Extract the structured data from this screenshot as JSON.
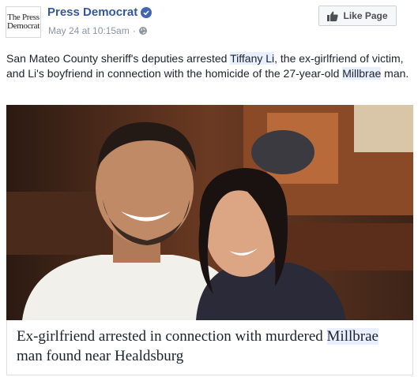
{
  "post": {
    "logo_line1": "The Press",
    "logo_line2": "Democrat",
    "page_name": "Press Democrat",
    "timestamp": "May 24 at 10:15am",
    "meta_separator": "·",
    "like_button": "Like Page",
    "text_parts": [
      "San Mateo County sheriff's deputies arrested ",
      "Tiffany Li",
      ", the ex-girlfriend of victim, and Li's boyfriend in connection with the homicide of the 27-year-old ",
      "Millbrae",
      " man."
    ],
    "caption_parts": [
      "Ex-girlfriend arrested in connection with murdered ",
      "Millbrae",
      " man found near Healdsburg"
    ]
  },
  "colors": {
    "link_blue": "#365899",
    "verified_blue": "#4267b2",
    "meta_gray": "#90949c",
    "highlight": "#e8efff"
  }
}
